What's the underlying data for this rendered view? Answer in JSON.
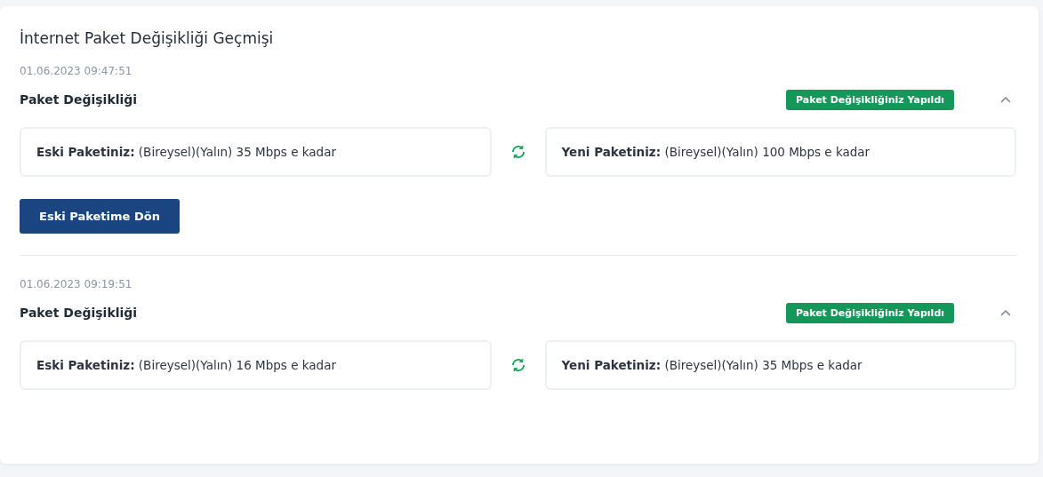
{
  "title": "İnternet Paket Değişikliği Geçmişi",
  "entries": [
    {
      "date": "01.06.2023 09:47:51",
      "heading": "Paket Değişikliği",
      "status": "Paket Değişikliğiniz Yapıldı",
      "expanded": true,
      "old": "**Eski Paketiniz:** (Bireysel)(Yalın) 35 Mbps e kadar",
      "new": "**Yeni Paketiniz:** (Bireysel)(Yalın) 100 Mbps e kadar",
      "button": "Eski Paketime Dön"
    },
    {
      "date": "01.06.2023 09:19:51",
      "heading": "Paket Değişikliği",
      "status": "Paket Değişikliğiniz Yapıldı",
      "expanded": true,
      "old": "**Eski Paketiniz:** (Bireysel)(Yalın) 16 Mbps e kadar",
      "new": "**Yeni Paketiniz:** (Bireysel)(Yalın) 35 Mbps e kadar"
    }
  ]
}
